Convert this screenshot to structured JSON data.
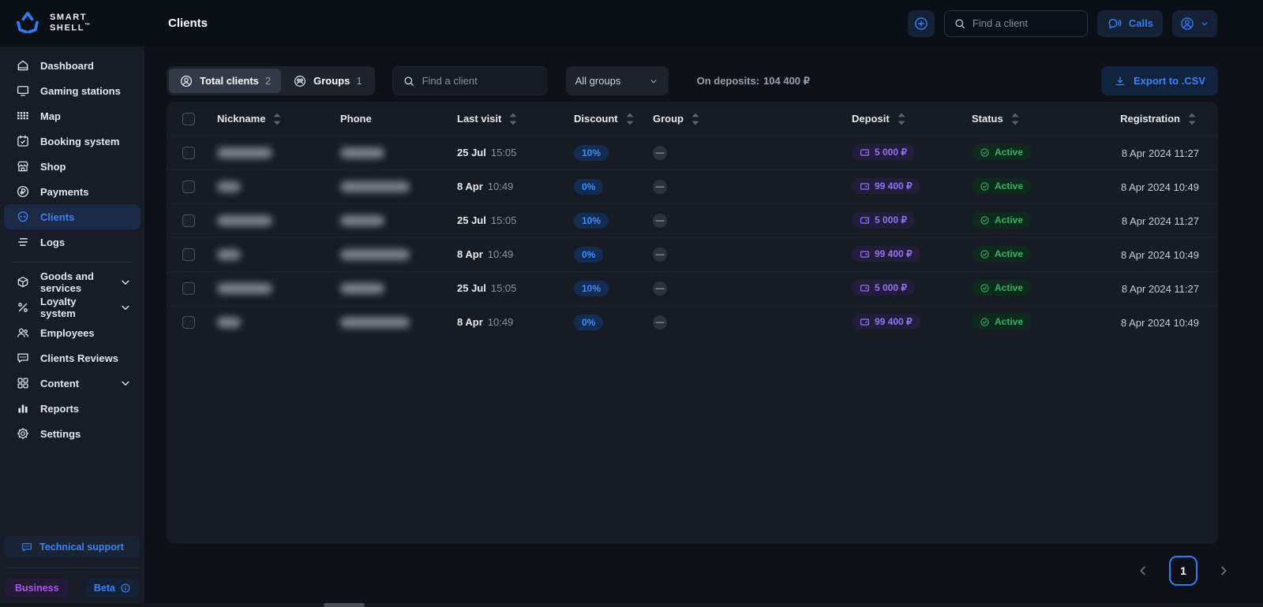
{
  "colors": {
    "accent_blue": "#2f7df6",
    "discount_text": "#3f8cff",
    "deposit_text": "#8a76f6",
    "status_green": "#2fb566",
    "business_purple": "#a855f7"
  },
  "brand": {
    "name_line1": "SMART",
    "name_line2": "SHELL",
    "trademark": "™"
  },
  "topbar": {
    "title": "Clients",
    "search_placeholder": "Find a client",
    "calls_label": "Calls"
  },
  "sidebar": {
    "items": [
      {
        "label": "Dashboard",
        "icon": "home",
        "active": false,
        "expandable": false,
        "divider_after": false
      },
      {
        "label": "Gaming stations",
        "icon": "monitor",
        "active": false,
        "expandable": false,
        "divider_after": false
      },
      {
        "label": "Map",
        "icon": "mapgrid",
        "active": false,
        "expandable": false,
        "divider_after": false
      },
      {
        "label": "Booking system",
        "icon": "calendar",
        "active": false,
        "expandable": false,
        "divider_after": false
      },
      {
        "label": "Shop",
        "icon": "shop",
        "active": false,
        "expandable": false,
        "divider_after": false
      },
      {
        "label": "Payments",
        "icon": "ruble",
        "active": false,
        "expandable": false,
        "divider_after": false
      },
      {
        "label": "Clients",
        "icon": "alien",
        "active": true,
        "expandable": false,
        "divider_after": false
      },
      {
        "label": "Logs",
        "icon": "logs",
        "active": false,
        "expandable": false,
        "divider_after": true
      },
      {
        "label": "Goods and services",
        "icon": "box",
        "active": false,
        "expandable": true,
        "divider_after": false
      },
      {
        "label": "Loyalty system",
        "icon": "percent",
        "active": false,
        "expandable": true,
        "divider_after": false
      },
      {
        "label": "Employees",
        "icon": "people",
        "active": false,
        "expandable": false,
        "divider_after": false
      },
      {
        "label": "Clients Reviews",
        "icon": "chat",
        "active": false,
        "expandable": false,
        "divider_after": false
      },
      {
        "label": "Content",
        "icon": "grid",
        "active": false,
        "expandable": true,
        "divider_after": false
      },
      {
        "label": "Reports",
        "icon": "chart",
        "active": false,
        "expandable": false,
        "divider_after": false
      },
      {
        "label": "Settings",
        "icon": "gear",
        "active": false,
        "expandable": false,
        "divider_after": false
      }
    ],
    "support_label": "Technical support",
    "business_badge": "Business",
    "beta_badge": "Beta"
  },
  "toolbar": {
    "tabs": [
      {
        "label": "Total clients",
        "count": "2",
        "icon": "personCircle",
        "active": true
      },
      {
        "label": "Groups",
        "count": "1",
        "icon": "groupCircle",
        "active": false
      }
    ],
    "search_placeholder": "Find a client",
    "group_filter_value": "All groups",
    "deposits_label": "On deposits:",
    "deposits_amount": "104 400 ₽",
    "export_label": "Export to .CSV"
  },
  "table": {
    "columns": [
      {
        "label": "Nickname",
        "sortable": true
      },
      {
        "label": "Phone",
        "sortable": false
      },
      {
        "label": "Last visit",
        "sortable": true
      },
      {
        "label": "Discount",
        "sortable": true
      },
      {
        "label": "Group",
        "sortable": true
      },
      {
        "label": "Deposit",
        "sortable": true
      },
      {
        "label": "Status",
        "sortable": true
      },
      {
        "label": "Registration",
        "sortable": true
      }
    ],
    "rows": [
      {
        "nickname_blur_w": 70,
        "phone_blur_w": 56,
        "last_visit_date": "25 Jul",
        "last_visit_time": "15:05",
        "discount": "10%",
        "group": "—",
        "deposit": "5 000 ₽",
        "status": "Active",
        "registration": "8 Apr 2024 11:27"
      },
      {
        "nickname_blur_w": 30,
        "phone_blur_w": 88,
        "last_visit_date": "8 Apr",
        "last_visit_time": "10:49",
        "discount": "0%",
        "group": "—",
        "deposit": "99 400 ₽",
        "status": "Active",
        "registration": "8 Apr 2024 10:49"
      },
      {
        "nickname_blur_w": 70,
        "phone_blur_w": 56,
        "last_visit_date": "25 Jul",
        "last_visit_time": "15:05",
        "discount": "10%",
        "group": "—",
        "deposit": "5 000 ₽",
        "status": "Active",
        "registration": "8 Apr 2024 11:27"
      },
      {
        "nickname_blur_w": 30,
        "phone_blur_w": 88,
        "last_visit_date": "8 Apr",
        "last_visit_time": "10:49",
        "discount": "0%",
        "group": "—",
        "deposit": "99 400 ₽",
        "status": "Active",
        "registration": "8 Apr 2024 10:49"
      },
      {
        "nickname_blur_w": 70,
        "phone_blur_w": 56,
        "last_visit_date": "25 Jul",
        "last_visit_time": "15:05",
        "discount": "10%",
        "group": "—",
        "deposit": "5 000 ₽",
        "status": "Active",
        "registration": "8 Apr 2024 11:27"
      },
      {
        "nickname_blur_w": 30,
        "phone_blur_w": 88,
        "last_visit_date": "8 Apr",
        "last_visit_time": "10:49",
        "discount": "0%",
        "group": "—",
        "deposit": "99 400 ₽",
        "status": "Active",
        "registration": "8 Apr 2024 10:49"
      }
    ]
  },
  "pagination": {
    "page": "1"
  }
}
